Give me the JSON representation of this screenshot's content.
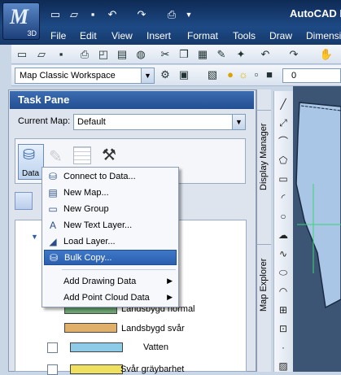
{
  "app": {
    "title": "AutoCAD M",
    "version_badge": "3D",
    "logo_letter": "M"
  },
  "quick_access": {
    "icons": [
      "new-icon",
      "open-icon",
      "save-icon",
      "undo-icon",
      "redo-icon",
      "print-icon",
      "dropdown-icon"
    ]
  },
  "menubar": {
    "items": [
      "File",
      "Edit",
      "View",
      "Insert",
      "Format",
      "Tools",
      "Draw",
      "Dimensio"
    ]
  },
  "workspace": {
    "value": "Map Classic Workspace"
  },
  "layer": {
    "value": "0"
  },
  "task_pane": {
    "title": "Task Pane",
    "current_map_label": "Current Map:",
    "current_map_value": "Default",
    "data_button_label": "Data"
  },
  "side_tabs": {
    "display_manager": "Display Manager",
    "map_explorer": "Map Explorer"
  },
  "context_menu": {
    "items": [
      {
        "label": "Connect to Data...",
        "icon": "database-connect-icon",
        "selected": false,
        "submenu": false
      },
      {
        "label": "New Map...",
        "icon": "new-map-icon",
        "selected": false,
        "submenu": false
      },
      {
        "label": "New Group",
        "icon": "folder-icon",
        "selected": false,
        "submenu": false
      },
      {
        "label": "New Text Layer...",
        "icon": "text-layer-icon",
        "selected": false,
        "submenu": false
      },
      {
        "label": "Load Layer...",
        "icon": "load-layer-icon",
        "selected": false,
        "submenu": false
      },
      {
        "label": "Bulk Copy...",
        "icon": "bulk-copy-icon",
        "selected": true,
        "submenu": false
      },
      {
        "label": "Add Drawing Data",
        "icon": "",
        "selected": false,
        "submenu": true
      },
      {
        "label": "Add Point Cloud Data",
        "icon": "",
        "selected": false,
        "submenu": true
      }
    ]
  },
  "legend": {
    "items": [
      {
        "label": "Landsbygd normal",
        "color": "#6aa673",
        "checkbox": false
      },
      {
        "label": "Landsbygd svår",
        "color": "#e0b06a",
        "checkbox": false
      },
      {
        "label": "Vatten",
        "color": "#8ecbe6",
        "checkbox": true
      },
      {
        "label": "Svår gräybarhet",
        "color": "#f0e060",
        "checkbox": true
      }
    ]
  },
  "colors": {
    "title_bar": "#1d4a86",
    "task_pane_header": "#2f5ea3",
    "selection": "#3268b8",
    "canvas": "#3c5575",
    "map_polygon": "#a9c6e6"
  }
}
